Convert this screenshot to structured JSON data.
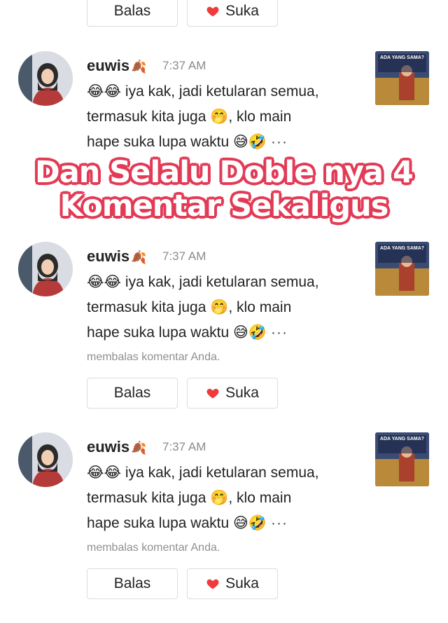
{
  "top_actions": {
    "reply_label": "Balas",
    "like_label": "Suka"
  },
  "comments": [
    {
      "username": "euwis",
      "time": "7:37 AM",
      "lines": [
        "😂😂 iya kak, jadi ketularan semua,",
        "termasuk kita juga 🤭, klo main",
        "hape suka lupa waktu 😅🤣"
      ],
      "more": "···",
      "replied_note": "",
      "reply_label": "",
      "like_label": "",
      "thumb_caption": "ADA YANG SAMA?"
    },
    {
      "username": "euwis",
      "time": "7:37 AM",
      "lines": [
        "😂😂 iya kak, jadi ketularan semua,",
        "termasuk kita juga 🤭, klo main",
        "hape suka lupa waktu 😅🤣"
      ],
      "more": "···",
      "replied_note": "membalas komentar Anda.",
      "reply_label": "Balas",
      "like_label": "Suka",
      "thumb_caption": "ADA YANG SAMA?"
    },
    {
      "username": "euwis",
      "time": "7:37 AM",
      "lines": [
        "😂😂 iya kak, jadi ketularan semua,",
        "termasuk kita juga 🤭, klo main",
        "hape suka lupa waktu 😅🤣"
      ],
      "more": "···",
      "replied_note": "membalas komentar Anda.",
      "reply_label": "Balas",
      "like_label": "Suka",
      "thumb_caption": "ADA YANG SAMA?"
    }
  ],
  "overlay": {
    "line1": "Dan Selalu Doble nya 4",
    "line2": "Komentar Sekaligus"
  },
  "colors": {
    "heart": "#ef3b3b",
    "overlay_stroke": "#e23b56",
    "muted": "#8f8f8f"
  },
  "icons": {
    "leaf": "🍂"
  }
}
